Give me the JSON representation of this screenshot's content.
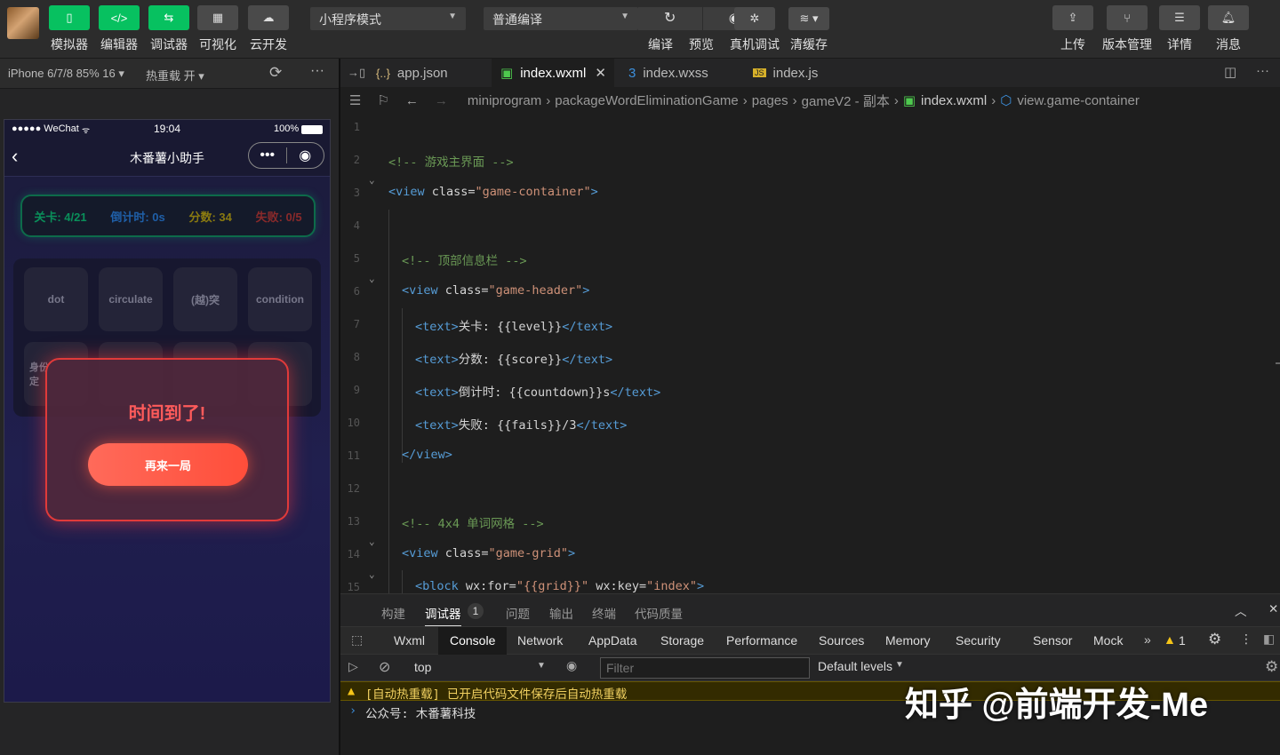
{
  "toolbar": {
    "left_buttons": [
      "模拟器",
      "编辑器",
      "调试器",
      "可视化",
      "云开发"
    ],
    "mode_select": "小程序模式",
    "compile_select": "普通编译",
    "mid_buttons": [
      "编译",
      "预览",
      "真机调试",
      "清缓存"
    ],
    "right_buttons": [
      "上传",
      "版本管理",
      "详情",
      "消息"
    ]
  },
  "simulator": {
    "device": "iPhone 6/7/8 85% 16 ▾",
    "hot_reload": "热重载 开 ▾",
    "status_carrier": "●●●●● WeChat",
    "status_time": "19:04",
    "status_battery": "100%",
    "nav_title": "木番薯小助手",
    "info": {
      "level": "关卡: 4/21",
      "timer": "倒计时: 0s",
      "score": "分数: 34",
      "fails": "失败: 0/5"
    },
    "grid_words": [
      "dot",
      "circulate",
      "(越)突",
      "condition"
    ],
    "partial_word": "身份\n定",
    "modal_title": "时间到了!",
    "modal_button": "再来一局"
  },
  "tabs": [
    "app.json",
    "index.wxml",
    "index.wxss",
    "index.js"
  ],
  "breadcrumb": [
    "miniprogram",
    "packageWordEliminationGame",
    "pages",
    "gameV2 - 副本",
    "index.wxml",
    "view.game-container"
  ],
  "code_lines": [
    {
      "n": "1",
      "parts": []
    },
    {
      "n": "2",
      "indent": 0,
      "parts": [
        [
          "com",
          "<!-- 游戏主界面 -->"
        ]
      ]
    },
    {
      "n": "3",
      "indent": 0,
      "fold": true,
      "parts": [
        [
          "tag",
          "<view"
        ],
        [
          "att",
          " class="
        ],
        [
          "str",
          "\"game-container\""
        ],
        [
          "tag",
          ">"
        ]
      ]
    },
    {
      "n": "4",
      "parts": []
    },
    {
      "n": "5",
      "indent": 1,
      "parts": [
        [
          "com",
          "<!-- 顶部信息栏 -->"
        ]
      ]
    },
    {
      "n": "6",
      "indent": 1,
      "fold": true,
      "parts": [
        [
          "tag",
          "<view"
        ],
        [
          "att",
          " class="
        ],
        [
          "str",
          "\"game-header\""
        ],
        [
          "tag",
          ">"
        ]
      ]
    },
    {
      "n": "7",
      "indent": 2,
      "parts": [
        [
          "tag",
          "<text>"
        ],
        [
          "txt",
          "关卡: {{level}}"
        ],
        [
          "tag",
          "</text>"
        ]
      ]
    },
    {
      "n": "8",
      "indent": 2,
      "parts": [
        [
          "tag",
          "<text>"
        ],
        [
          "txt",
          "分数: {{score}}"
        ],
        [
          "tag",
          "</text>"
        ]
      ]
    },
    {
      "n": "9",
      "indent": 2,
      "parts": [
        [
          "tag",
          "<text>"
        ],
        [
          "txt",
          "倒计时: {{countdown}}s"
        ],
        [
          "tag",
          "</text>"
        ]
      ]
    },
    {
      "n": "10",
      "indent": 2,
      "parts": [
        [
          "tag",
          "<text>"
        ],
        [
          "txt",
          "失败: {{fails}}/3"
        ],
        [
          "tag",
          "</text>"
        ]
      ]
    },
    {
      "n": "11",
      "indent": 1,
      "parts": [
        [
          "tag",
          "</view>"
        ]
      ]
    },
    {
      "n": "12",
      "parts": []
    },
    {
      "n": "13",
      "indent": 1,
      "parts": [
        [
          "com",
          "<!-- 4x4 单词网格 -->"
        ]
      ]
    },
    {
      "n": "14",
      "indent": 1,
      "fold": true,
      "parts": [
        [
          "tag",
          "<view"
        ],
        [
          "att",
          " class="
        ],
        [
          "str",
          "\"game-grid\""
        ],
        [
          "tag",
          ">"
        ]
      ]
    },
    {
      "n": "15",
      "indent": 2,
      "fold": true,
      "parts": [
        [
          "tag",
          "<block"
        ],
        [
          "att",
          " wx:for="
        ],
        [
          "str",
          "\"{{grid}}\""
        ],
        [
          "att",
          " wx:key="
        ],
        [
          "str",
          "\"index\""
        ],
        [
          "tag",
          ">"
        ]
      ]
    }
  ],
  "panel_tabs": [
    "构建",
    "调试器",
    "问题",
    "输出",
    "终端",
    "代码质量"
  ],
  "debugger_badge": "1",
  "devtools_tabs": [
    "Wxml",
    "Console",
    "Network",
    "AppData",
    "Storage",
    "Performance",
    "Sources",
    "Memory",
    "Security",
    "Sensor",
    "Mock"
  ],
  "warn_count": "1",
  "context_select": "top",
  "filter_placeholder": "Filter",
  "levels_select": "Default levels",
  "console": {
    "warning": "[自动热重载] 已开启代码文件保存后自动热重载",
    "log": "公众号: 木番薯科技"
  },
  "watermark": "知乎 @前端开发-Me",
  "colors": {
    "accent_green": "#07c160",
    "modal_red": "#ff5b5b",
    "level_green": "#0a8f5a"
  }
}
